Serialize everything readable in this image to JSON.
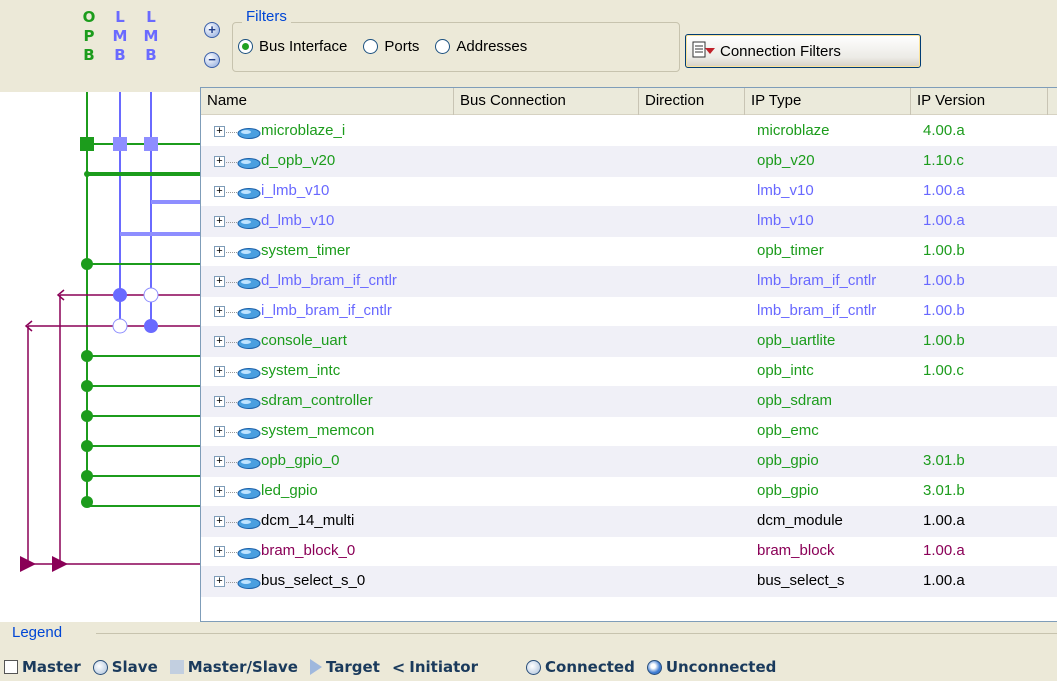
{
  "bus_columns": [
    {
      "letters": [
        "O",
        "P",
        "B"
      ],
      "color": "#1c9c1c"
    },
    {
      "letters": [
        "L",
        "M",
        "B"
      ],
      "color": "#6a6aff"
    },
    {
      "letters": [
        "L",
        "M",
        "B"
      ],
      "color": "#6a6aff"
    }
  ],
  "zoom": {
    "in": "+",
    "out": "−"
  },
  "filters": {
    "title": "Filters",
    "options": [
      {
        "label": "Bus Interface",
        "selected": true
      },
      {
        "label": "Ports",
        "selected": false
      },
      {
        "label": "Addresses",
        "selected": false
      }
    ],
    "connection_filters_label": "Connection Filters"
  },
  "table": {
    "columns": [
      "Name",
      "Bus Connection",
      "Direction",
      "IP Type",
      "IP Version"
    ],
    "rows": [
      {
        "name": "microblaze_i",
        "ip_type": "microblaze",
        "ip_version": "4.00.a",
        "color": "green"
      },
      {
        "name": "d_opb_v20",
        "ip_type": "opb_v20",
        "ip_version": "1.10.c",
        "color": "green"
      },
      {
        "name": "i_lmb_v10",
        "ip_type": "lmb_v10",
        "ip_version": "1.00.a",
        "color": "blue"
      },
      {
        "name": "d_lmb_v10",
        "ip_type": "lmb_v10",
        "ip_version": "1.00.a",
        "color": "blue"
      },
      {
        "name": "system_timer",
        "ip_type": "opb_timer",
        "ip_version": "1.00.b",
        "color": "green"
      },
      {
        "name": "d_lmb_bram_if_cntlr",
        "ip_type": "lmb_bram_if_cntlr",
        "ip_version": "1.00.b",
        "color": "blue"
      },
      {
        "name": "i_lmb_bram_if_cntlr",
        "ip_type": "lmb_bram_if_cntlr",
        "ip_version": "1.00.b",
        "color": "blue"
      },
      {
        "name": "console_uart",
        "ip_type": "opb_uartlite",
        "ip_version": "1.00.b",
        "color": "green"
      },
      {
        "name": "system_intc",
        "ip_type": "opb_intc",
        "ip_version": "1.00.c",
        "color": "green"
      },
      {
        "name": "sdram_controller",
        "ip_type": "opb_sdram",
        "ip_version": "",
        "color": "green"
      },
      {
        "name": "system_memcon",
        "ip_type": "opb_emc",
        "ip_version": "",
        "color": "green"
      },
      {
        "name": "opb_gpio_0",
        "ip_type": "opb_gpio",
        "ip_version": "3.01.b",
        "color": "green"
      },
      {
        "name": "led_gpio",
        "ip_type": "opb_gpio",
        "ip_version": "3.01.b",
        "color": "green"
      },
      {
        "name": "dcm_14_multi",
        "ip_type": "dcm_module",
        "ip_version": "1.00.a",
        "color": "black"
      },
      {
        "name": "bram_block_0",
        "ip_type": "bram_block",
        "ip_version": "1.00.a",
        "color": "purple"
      },
      {
        "name": "bus_select_s_0",
        "ip_type": "bus_select_s",
        "ip_version": "1.00.a",
        "color": "black"
      }
    ]
  },
  "legend": {
    "title": "Legend",
    "items": [
      "Master",
      "Slave",
      "Master/Slave",
      "Target",
      "Initiator",
      "Connected",
      "Unconnected"
    ]
  },
  "colors": {
    "opb": "#1c9c1c",
    "lmb": "#6a6aff",
    "bram": "#8a0057",
    "accent": "#0046d5"
  }
}
